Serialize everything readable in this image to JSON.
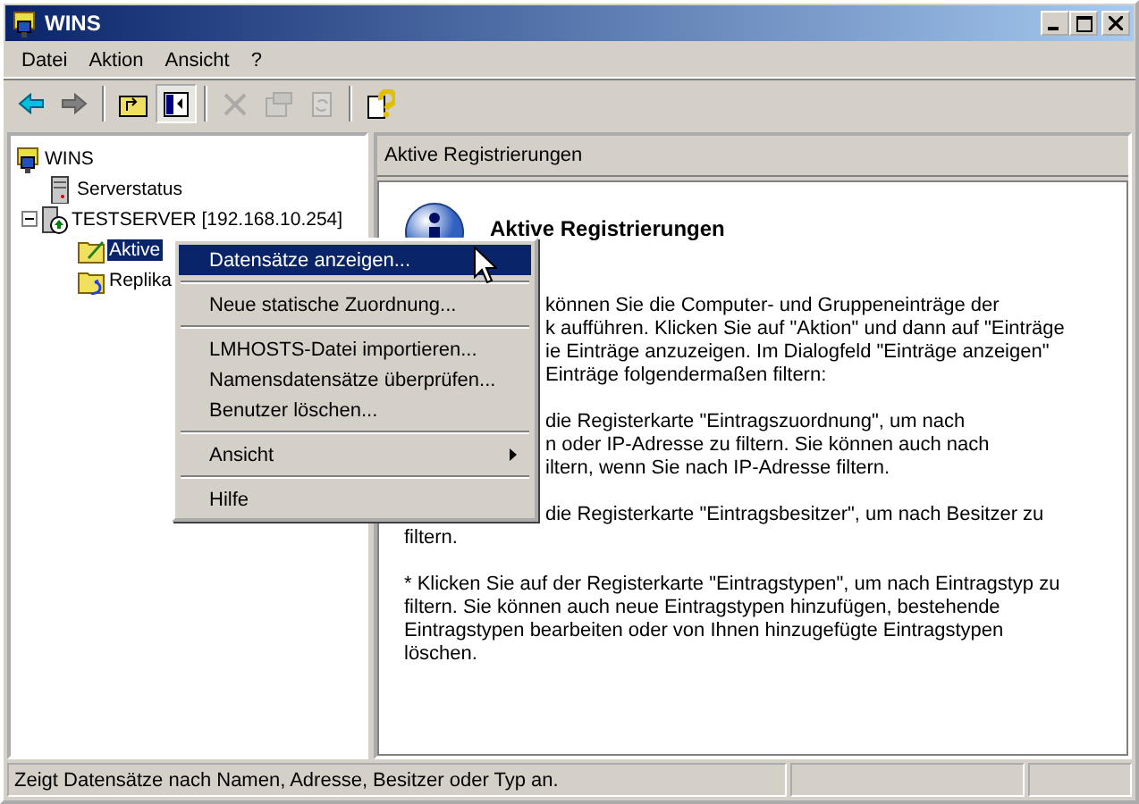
{
  "window": {
    "title": "WINS"
  },
  "menu_bar": [
    "Datei",
    "Aktion",
    "Ansicht",
    "?"
  ],
  "toolbar": [
    {
      "kind": "back",
      "disabled": false,
      "pressed": false
    },
    {
      "kind": "forward",
      "disabled": false,
      "pressed": false
    },
    {
      "kind": "separator"
    },
    {
      "kind": "up",
      "disabled": false,
      "pressed": false
    },
    {
      "kind": "tree",
      "disabled": false,
      "pressed": true
    },
    {
      "kind": "separator"
    },
    {
      "kind": "delete",
      "disabled": true,
      "pressed": false
    },
    {
      "kind": "properties",
      "disabled": true,
      "pressed": false
    },
    {
      "kind": "refresh",
      "disabled": true,
      "pressed": false
    },
    {
      "kind": "separator"
    },
    {
      "kind": "help",
      "disabled": false,
      "pressed": false
    }
  ],
  "tree": [
    {
      "label": "WINS",
      "kind": "root",
      "selected": false,
      "children": [
        {
          "label": "Serverstatus",
          "kind": "status",
          "selected": false
        },
        {
          "label": "TESTSERVER [192.168.10.254]",
          "kind": "server",
          "selected": false,
          "expanded": true,
          "children": [
            {
              "label": "Aktive",
              "kind": "active",
              "selected": true
            },
            {
              "label": "Replika",
              "kind": "replication",
              "selected": false
            }
          ]
        }
      ]
    }
  ],
  "content": {
    "header": "Aktive Registrierungen",
    "title": "Aktive Registrierungen",
    "lines": [
      {
        "kind": "fragment",
        "text": "können Sie die Computer- und Gruppeneinträge der"
      },
      {
        "kind": "fragment",
        "text": "k aufführen. Klicken Sie auf \"Aktion\" und dann auf \"Einträge"
      },
      {
        "kind": "fragment",
        "text": "ie Einträge anzuzeigen. Im Dialogfeld \"Einträge anzeigen\""
      },
      {
        "kind": "fragment",
        "text": "Einträge folgendermaßen filtern:"
      },
      {
        "kind": "blank"
      },
      {
        "kind": "fragment",
        "text": "die Registerkarte \"Eintragszuordnung\", um nach"
      },
      {
        "kind": "fragment",
        "text": "n oder IP-Adresse zu filtern. Sie können auch nach"
      },
      {
        "kind": "fragment",
        "text": "iltern, wenn Sie nach IP-Adresse filtern."
      },
      {
        "kind": "blank"
      },
      {
        "kind": "fragment",
        "text": "die Registerkarte \"Eintragsbesitzer\", um nach Besitzer zu"
      },
      {
        "kind": "line",
        "text": "filtern."
      },
      {
        "kind": "blank"
      },
      {
        "kind": "line",
        "text": "* Klicken Sie auf der Registerkarte \"Eintragstypen\", um nach Eintragstyp zu"
      },
      {
        "kind": "line",
        "text": "filtern. Sie können auch neue Eintragstypen hinzufügen, bestehende"
      },
      {
        "kind": "line",
        "text": "Eintragstypen bearbeiten oder von Ihnen hinzugefügte Eintragstypen"
      },
      {
        "kind": "line",
        "text": "löschen."
      }
    ]
  },
  "context_menu": [
    {
      "kind": "item",
      "label": "Datensätze anzeigen...",
      "selected": true,
      "submenu": false
    },
    {
      "kind": "separator"
    },
    {
      "kind": "item",
      "label": "Neue statische Zuordnung...",
      "selected": false,
      "submenu": false
    },
    {
      "kind": "separator"
    },
    {
      "kind": "item",
      "label": "LMHOSTS-Datei importieren...",
      "selected": false,
      "submenu": false
    },
    {
      "kind": "item",
      "label": "Namensdatensätze überprüfen...",
      "selected": false,
      "submenu": false
    },
    {
      "kind": "item",
      "label": "Benutzer löschen...",
      "selected": false,
      "submenu": false
    },
    {
      "kind": "separator"
    },
    {
      "kind": "item",
      "label": "Ansicht",
      "selected": false,
      "submenu": true
    },
    {
      "kind": "separator"
    },
    {
      "kind": "item",
      "label": "Hilfe",
      "selected": false,
      "submenu": false
    }
  ],
  "status_bar": [
    "Zeigt Datensätze nach Namen, Adresse, Besitzer oder Typ an."
  ]
}
